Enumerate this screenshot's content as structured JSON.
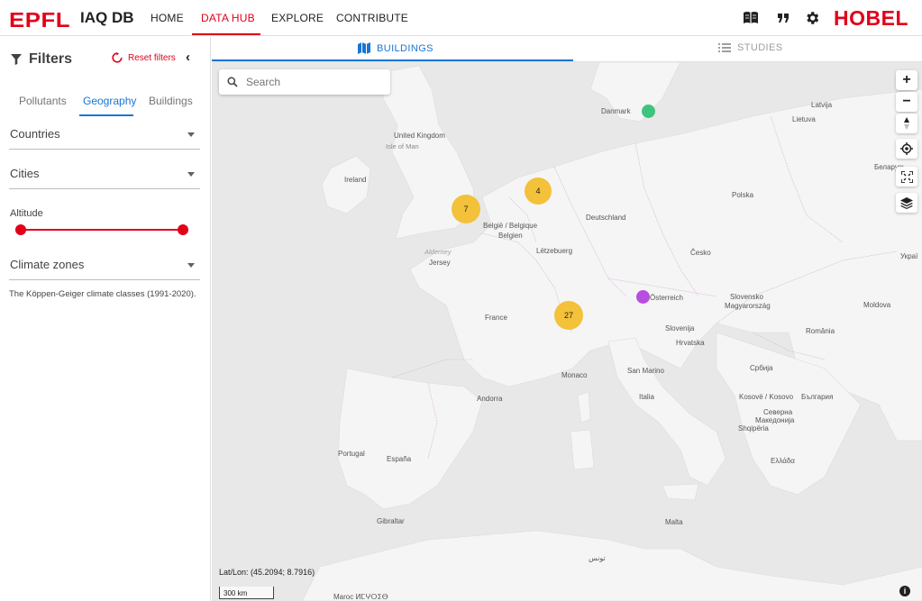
{
  "nav": {
    "brand": "EPFL",
    "app_title": "IAQ DB",
    "links": [
      "HOME",
      "DATA HUB",
      "EXPLORE",
      "CONTRIBUTE"
    ],
    "active_link": "DATA HUB",
    "right_logo": "HOBEL",
    "icons": [
      "book-icon",
      "quote-icon",
      "gear-icon"
    ]
  },
  "sidebar": {
    "title": "Filters",
    "reset_label": "Reset filters",
    "subtabs": [
      "Pollutants",
      "Geography",
      "Buildings"
    ],
    "active_subtab": "Geography",
    "countries_label": "Countries",
    "cities_label": "Cities",
    "altitude_label": "Altitude",
    "climate_label": "Climate zones",
    "climate_caption": "The Köppen-Geiger climate classes (1991-2020)."
  },
  "map_tabs": {
    "buildings": "BUILDINGS",
    "studies": "STUDIES",
    "active": "BUILDINGS"
  },
  "map": {
    "search_placeholder": "Search",
    "latlon": "Lat/Lon: (45.2094; 8.7916)",
    "scale": "300 km",
    "clusters": [
      {
        "count": "7",
        "near": "England"
      },
      {
        "count": "4",
        "near": "Nederland"
      },
      {
        "count": "27",
        "near": "Suisse"
      }
    ],
    "points": [
      {
        "near": "Danmark",
        "color": "#3dc47e"
      },
      {
        "near": "Tirol",
        "color": "#b84ee0"
      }
    ],
    "labels": {
      "united_kingdom": "United Kingdom",
      "isle_of_man": "Isle of Man",
      "ireland": "Ireland",
      "danmark": "Danmark",
      "latvija": "Latvija",
      "lietuva": "Lietuva",
      "deutschland": "Deutschland",
      "belgie": "België / Belgique",
      "belgien": "Belgien",
      "letzebuerg": "Lëtzebuerg",
      "cesko": "Česko",
      "slovensko": "Slovensko",
      "osterreich": "Österreich",
      "magyarorszag": "Magyarország",
      "moldova": "Moldova",
      "romania": "România",
      "france": "France",
      "slovenija": "Slovenija",
      "hrvatska": "Hrvatska",
      "srbija": "Србија",
      "kosovo": "Kosovë / Kosovo",
      "bulgaria": "България",
      "severna": "Северна",
      "makedonija": "Македонија",
      "shqiperia": "Shqipëria",
      "ellada": "Ελλάδα",
      "italia": "Italia",
      "san_marino": "San Marino",
      "monaco": "Monaco",
      "andorra": "Andorra",
      "espana": "España",
      "portugal": "Portugal",
      "gibraltar": "Gibraltar",
      "malta": "Malta",
      "jersey": "Jersey",
      "alderney": "Alderney",
      "polska": "Polska",
      "belarus": "Беларусь",
      "ukraine": "Украї",
      "tunis": "تونس",
      "maroc": "Maroc ⵍⵎⵖⵔⵉⴱ"
    }
  }
}
